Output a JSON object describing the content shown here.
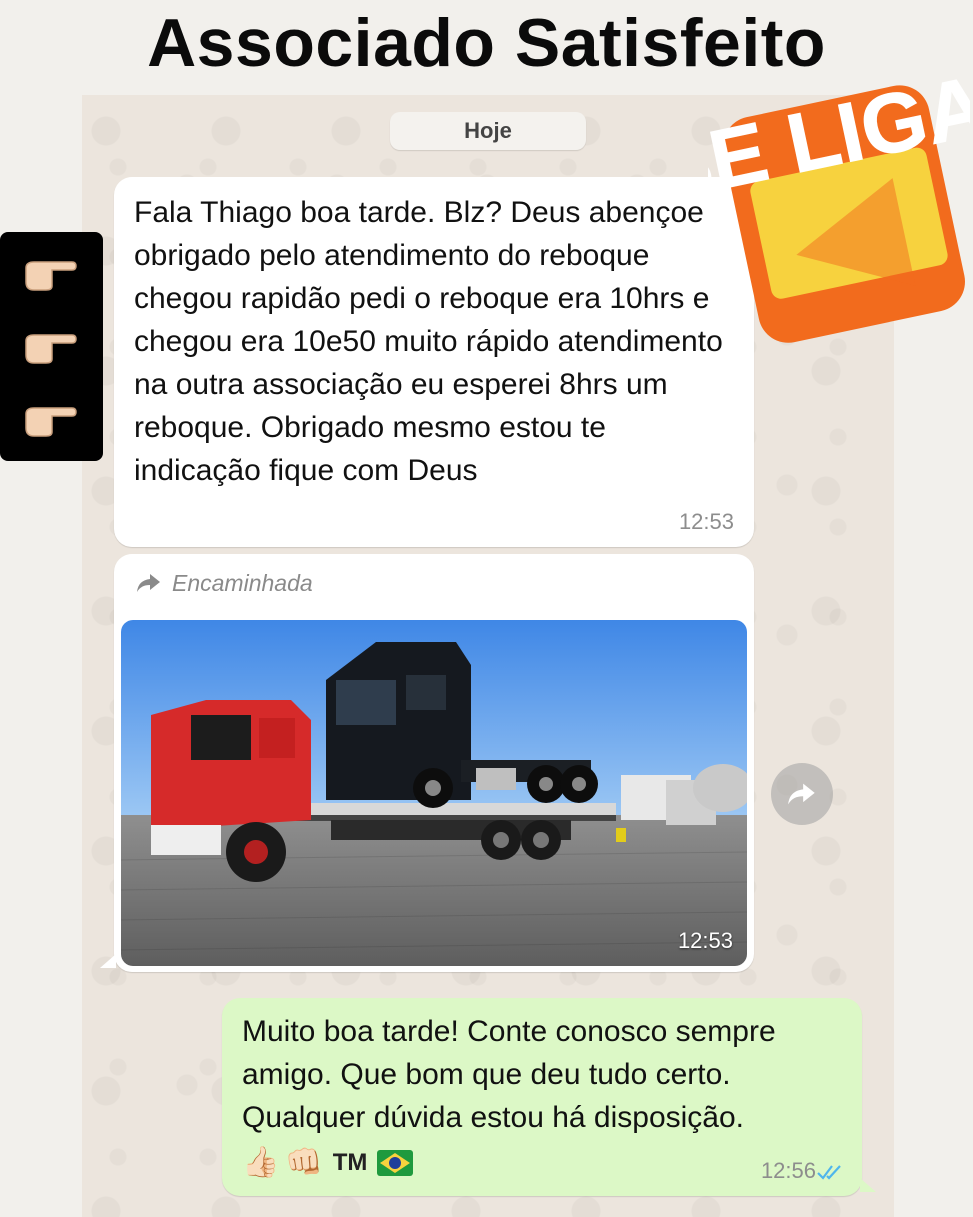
{
  "header": {
    "title": "Associado Satisfeito"
  },
  "sticker": {
    "text": "SE LIGA"
  },
  "chat": {
    "date_label": "Hoje",
    "messages": [
      {
        "direction": "incoming",
        "text": "Fala Thiago boa tarde. Blz? Deus abençoe obrigado pelo atendimento do reboque chegou rapidão pedi o reboque era 10hrs e chegou era 10e50 muito rápido atendimento na outra associação eu esperei 8hrs um reboque. Obrigado mesmo estou te indicação fique com Deus",
        "time": "12:53"
      },
      {
        "direction": "incoming",
        "forwarded_label": "Encaminhada",
        "media": "image",
        "time": "12:53"
      },
      {
        "direction": "outgoing",
        "text": "Muito boa tarde! Conte conosco sempre amigo. Que bom que deu tudo certo. Qualquer dúvida estou há disposição.",
        "emojis": [
          "👍🏻",
          "👊🏻"
        ],
        "tm": "TM",
        "flag": "brazil-flag",
        "time": "12:56",
        "status": "read"
      }
    ]
  },
  "icons": {
    "forward": "forward-arrow-icon",
    "share": "share-arrow-icon",
    "read_ticks": "double-check-icon",
    "pointer": "pointing-hand-icon"
  },
  "colors": {
    "incoming_bubble": "#ffffff",
    "outgoing_bubble": "#dcf8c6",
    "read_ticks": "#4fb6ec",
    "sticker_orange": "#f26b1d",
    "sticker_yellow": "#f7d23e"
  }
}
